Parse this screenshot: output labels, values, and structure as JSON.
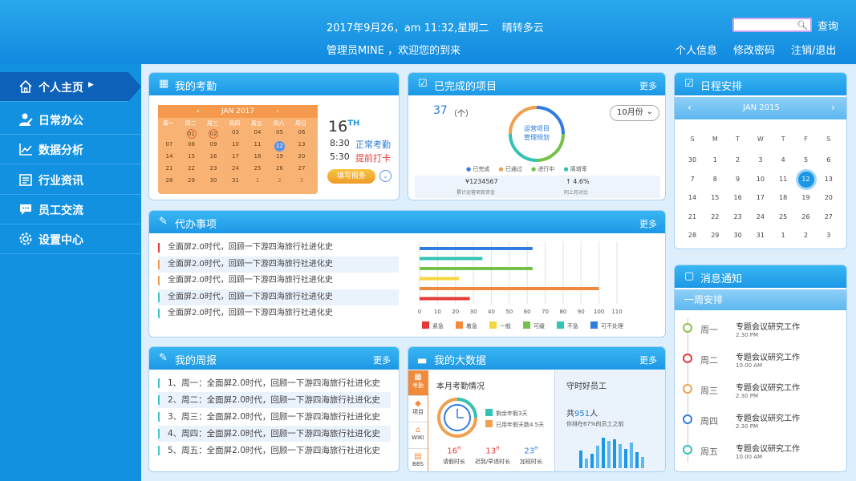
{
  "header": {
    "datetime": "2017年9月26，am 11:32,星期二",
    "weather": "晴转多云",
    "welcome": "管理员MINE ，欢迎您的到来",
    "search_placeholder": "",
    "search_btn": "查询",
    "links": [
      "个人信息",
      "修改密码",
      "注销/退出"
    ]
  },
  "sidebar": {
    "items": [
      {
        "label": "个人主页",
        "icon": "home-icon"
      },
      {
        "label": "日常办公",
        "icon": "user-icon"
      },
      {
        "label": "数据分析",
        "icon": "chart-icon"
      },
      {
        "label": "行业资讯",
        "icon": "news-icon"
      },
      {
        "label": "员工交流",
        "icon": "chat-icon"
      },
      {
        "label": "设置中心",
        "icon": "gear-icon"
      }
    ]
  },
  "attendance": {
    "title": "我的考勤",
    "month": "JAN  2017",
    "weekdays": [
      "周一",
      "周二",
      "周三",
      "周四",
      "周五",
      "周六",
      "周日"
    ],
    "days": [
      [
        "",
        "01",
        "02",
        "03",
        "04",
        "05",
        "06"
      ],
      [
        "07",
        "08",
        "09",
        "10",
        "11",
        "12",
        "13"
      ],
      [
        "14",
        "15",
        "16",
        "17",
        "18",
        "19",
        "20"
      ],
      [
        "21",
        "22",
        "23",
        "24",
        "25",
        "26",
        "27"
      ],
      [
        "28",
        "29",
        "30",
        "31",
        "1",
        "2",
        "3"
      ]
    ],
    "today_day": "16",
    "today_suffix": "TH",
    "time1": "8:30",
    "status1": "正常考勤",
    "time2": "5:30",
    "status2": "提前打卡",
    "fill_btn": "填写假条"
  },
  "projects": {
    "title": "已完成的项目",
    "more": "更多",
    "count": "37",
    "unit": "（个）",
    "month_select": "10月份",
    "ring_label1": "运营项目",
    "ring_label2": "管理规划",
    "legend": [
      "已完成",
      "已通过",
      "进行中",
      "周增率"
    ],
    "stat1_value": "¥1234567",
    "stat1_label": "累计运营项目资金",
    "stat2_value": "4.6%",
    "stat2_label": "同上月对比"
  },
  "schedule": {
    "title": "日程安排",
    "month": "JAN    2015",
    "weekdays": [
      "S",
      "M",
      "T",
      "W",
      "T",
      "F",
      "S"
    ],
    "days": [
      [
        "30",
        "1",
        "2",
        "3",
        "4",
        "5",
        "6"
      ],
      [
        "7",
        "8",
        "9",
        "10",
        "11",
        "12",
        "13"
      ],
      [
        "14",
        "15",
        "16",
        "17",
        "18",
        "19",
        "20"
      ],
      [
        "21",
        "22",
        "23",
        "24",
        "25",
        "26",
        "27"
      ],
      [
        "28",
        "29",
        "30",
        "31",
        "1",
        "2",
        "3"
      ]
    ]
  },
  "todo": {
    "title": "代办事项",
    "more": "更多",
    "items": [
      "全面屏2.0时代，回顾一下游四海旅行社进化史",
      "全面屏2.0时代，回顾一下游四海旅行社进化史",
      "全面屏2.0时代，回顾一下游四海旅行社进化史",
      "全面屏2.0时代，回顾一下游四海旅行社进化史",
      "全面屏2.0时代，回顾一下游四海旅行社进化史"
    ],
    "colors": [
      "#e53935",
      "#f0a050",
      "#f0a050",
      "#42c5c0",
      "#42c5c0"
    ]
  },
  "chart_data": {
    "type": "bar",
    "orientation": "horizontal",
    "xlim": [
      0,
      110
    ],
    "ticks": [
      "0",
      "10",
      "20",
      "30",
      "40",
      "50",
      "60",
      "70",
      "80",
      "90",
      "100",
      "110"
    ],
    "bars": [
      {
        "color": "#2f7de0",
        "value": 63
      },
      {
        "color": "#31c3b4",
        "value": 35
      },
      {
        "color": "#75c14a",
        "value": 63
      },
      {
        "color": "#f5d63f",
        "value": 22
      },
      {
        "color": "#f08a3c",
        "value": 100
      },
      {
        "color": "#e53935",
        "value": 28
      }
    ],
    "legend": [
      {
        "name": "紧急",
        "color": "#e53935"
      },
      {
        "name": "着急",
        "color": "#f08a3c"
      },
      {
        "name": "一般",
        "color": "#f5d63f"
      },
      {
        "name": "可缓",
        "color": "#75c14a"
      },
      {
        "name": "不急",
        "color": "#31c3b4"
      },
      {
        "name": "可不处理",
        "color": "#2f7de0"
      }
    ]
  },
  "weekly": {
    "title": "我的周报",
    "more": "更多",
    "items": [
      "1、周一：全面屏2.0时代，回顾一下游四海旅行社进化史",
      "2、周二：全面屏2.0时代，回顾一下游四海旅行社进化史",
      "3、周三：全面屏2.0时代，回顾一下游四海旅行社进化史",
      "4、周四：全面屏2.0时代，回顾一下游四海旅行社进化史",
      "5、周五：全面屏2.0时代，回顾一下游四海旅行社进化史"
    ]
  },
  "bigdata": {
    "title": "我的大数据",
    "more": "更多",
    "tabs": [
      "考勤",
      "项目",
      "WIKI",
      "BBS"
    ],
    "section_title": "本月考勤情况",
    "legend1": "剩余年假3天",
    "legend2": "已用年假天数4.5天",
    "stats": [
      {
        "value": "16",
        "unit": "H",
        "label": "请假时长"
      },
      {
        "value": "13",
        "unit": "H",
        "label": "迟到/早退时长"
      },
      {
        "value": "23",
        "unit": "H",
        "label": "加班时长"
      }
    ],
    "staff_title": "守时好员工",
    "staff_count_prefix": "共",
    "staff_count": "951",
    "staff_count_unit": "人",
    "staff_note": "你排在67%的员工之前",
    "mini_bars": [
      0.55,
      0.3,
      0.45,
      0.7,
      0.95,
      0.85,
      0.9,
      0.75,
      0.6,
      0.8,
      0.5,
      0.35
    ]
  },
  "messages": {
    "title": "消息通知",
    "subtitle": "一周安排",
    "items": [
      {
        "day": "周一",
        "title": "专题会议研究工作",
        "time": "2.30 PM",
        "color": "#8bc34a"
      },
      {
        "day": "周二",
        "title": "专题会议研究工作",
        "time": "10.00 AM",
        "color": "#e53935"
      },
      {
        "day": "周三",
        "title": "专题会议研究工作",
        "time": "2.30 PM",
        "color": "#f0a050"
      },
      {
        "day": "周四",
        "title": "专题会议研究工作",
        "time": "2.30 PM",
        "color": "#2f7de0"
      },
      {
        "day": "周五",
        "title": "专题会议研究工作",
        "time": "10.00 AM",
        "color": "#31c3b4"
      }
    ]
  }
}
